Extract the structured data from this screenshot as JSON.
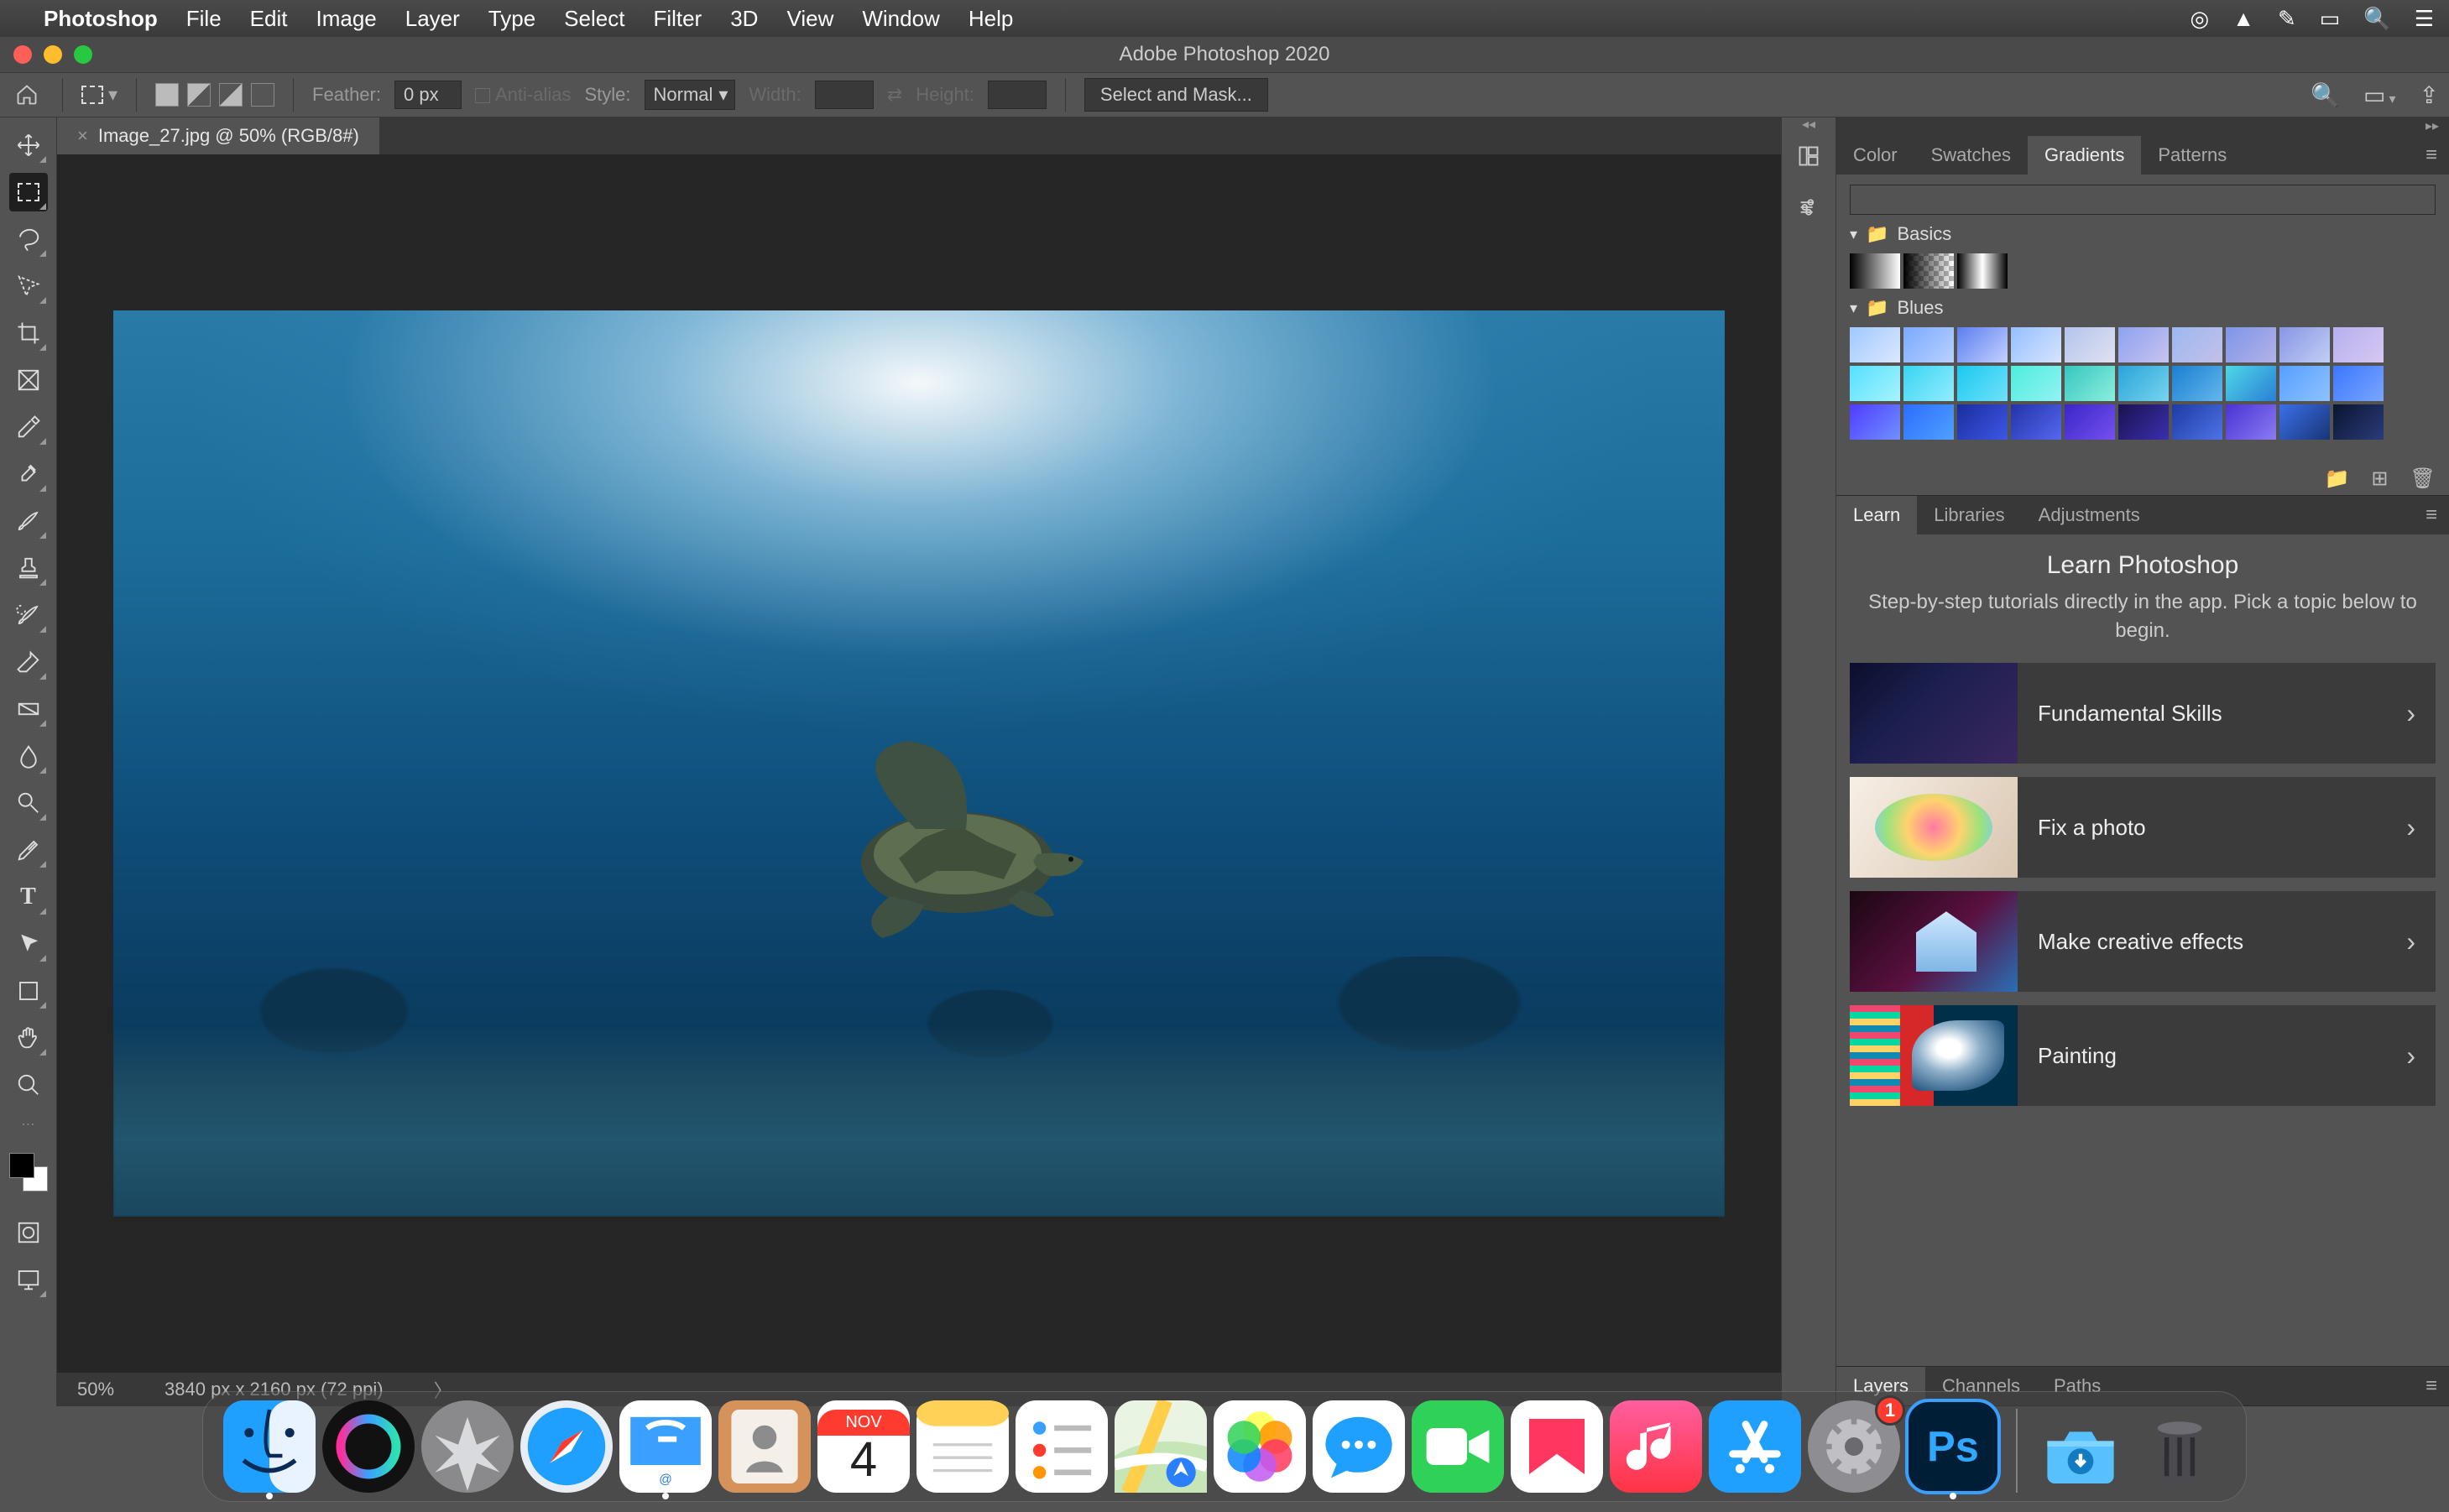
{
  "macmenu": {
    "app": "Photoshop",
    "items": [
      "File",
      "Edit",
      "Image",
      "Layer",
      "Type",
      "Select",
      "Filter",
      "3D",
      "View",
      "Window",
      "Help"
    ]
  },
  "window": {
    "title": "Adobe Photoshop 2020"
  },
  "optionsbar": {
    "feather_label": "Feather:",
    "feather_value": "0 px",
    "antialias_label": "Anti-alias",
    "style_label": "Style:",
    "style_value": "Normal",
    "width_label": "Width:",
    "height_label": "Height:",
    "select_mask": "Select and Mask..."
  },
  "document": {
    "tab_label": "Image_27.jpg @ 50% (RGB/8#)",
    "zoom_status": "50%",
    "dims_status": "3840 px x 2160 px (72 ppi)"
  },
  "tools": {
    "names": [
      "move",
      "marquee",
      "lasso",
      "quick-select",
      "crop",
      "frame",
      "eyedropper",
      "healing",
      "brush",
      "stamp",
      "history-brush",
      "eraser",
      "gradient",
      "blur",
      "dodge",
      "pen",
      "type",
      "path-select",
      "shape",
      "hand",
      "zoom"
    ]
  },
  "panels": {
    "group1_tabs": [
      "Color",
      "Swatches",
      "Gradients",
      "Patterns"
    ],
    "group1_active": "Gradients",
    "gradients": {
      "folders": {
        "basics": {
          "label": "Basics"
        },
        "blues": {
          "label": "Blues"
        }
      }
    },
    "group2_tabs": [
      "Learn",
      "Libraries",
      "Adjustments"
    ],
    "group2_active": "Learn",
    "learn": {
      "title": "Learn Photoshop",
      "subtitle": "Step-by-step tutorials directly in the app. Pick a topic below to begin.",
      "cards": [
        "Fundamental Skills",
        "Fix a photo",
        "Make creative effects",
        "Painting"
      ]
    },
    "group3_tabs": [
      "Layers",
      "Channels",
      "Paths"
    ],
    "group3_active": "Layers"
  },
  "dock": {
    "items": [
      "finder",
      "siri",
      "launchpad",
      "safari",
      "mail",
      "contacts",
      "calendar",
      "notes",
      "reminders",
      "maps",
      "photos",
      "messages",
      "facetime",
      "news",
      "music",
      "appstore",
      "settings",
      "photoshop"
    ],
    "calendar_month": "NOV",
    "calendar_day": "4",
    "settings_badge": "1",
    "after_sep": [
      "downloads",
      "trash"
    ]
  }
}
